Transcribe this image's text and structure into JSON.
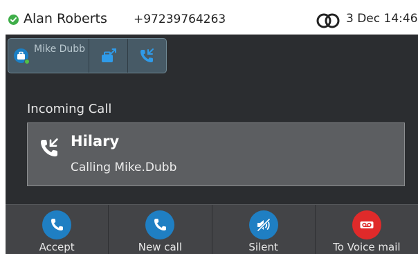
{
  "status_bar": {
    "user_name": "Alan Roberts",
    "user_number": "+97239764263",
    "datetime": "3 Dec 14:46",
    "presence_icon": "check-circle-icon",
    "presence_color": "#3fae49"
  },
  "line_tabs": [
    {
      "label": "Mike Dubb",
      "icon": "contact-icon"
    },
    {
      "icon": "briefcase-share-icon"
    },
    {
      "icon": "incoming-call-icon"
    }
  ],
  "main": {
    "title": "Incoming Call",
    "caller_name": "Hilary",
    "status_text": "Calling Mike.Dubb"
  },
  "softkeys": [
    {
      "label": "Accept",
      "icon": "phone-icon",
      "color": "#1f7fc3"
    },
    {
      "label": "New call",
      "icon": "phone-icon",
      "color": "#1f7fc3"
    },
    {
      "label": "Silent",
      "icon": "speaker-mute-icon",
      "color": "#1f7fc3"
    },
    {
      "label": "To Voice mail",
      "icon": "voicemail-icon",
      "color": "#e02a2a"
    }
  ]
}
